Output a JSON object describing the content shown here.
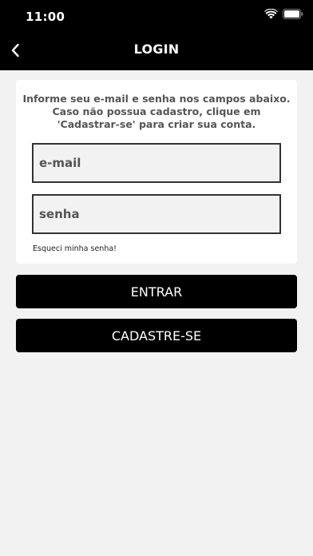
{
  "status_bar": {
    "time": "11:00",
    "wifi_icon": "wifi-icon",
    "battery_icon": "battery-icon"
  },
  "nav": {
    "title": "LOGIN",
    "back_icon": "chevron-left-icon"
  },
  "form": {
    "instructions": "Informe seu e-mail e senha nos campos abaixo. Caso não possua cadastro, clique em 'Cadastrar-se' para criar sua conta.",
    "email_placeholder": "e-mail",
    "password_placeholder": "senha",
    "forgot_password": "Esqueci minha senha!"
  },
  "actions": {
    "login_label": "ENTRAR",
    "register_label": "CADASTRE-SE"
  },
  "colors": {
    "header_bg": "#000000",
    "page_bg": "#f2f2f2",
    "card_bg": "#ffffff",
    "button_bg": "#000000",
    "button_text": "#ffffff"
  }
}
